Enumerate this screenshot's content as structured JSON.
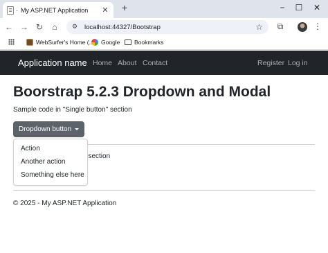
{
  "browser": {
    "tab": {
      "separator": "-",
      "title": "My ASP.NET Application"
    },
    "address": {
      "url": "localhost:44327/Bootstrap"
    },
    "bookmarks": [
      {
        "label": "WebSurfer's Home (...",
        "icon": "websurfer-favicon"
      },
      {
        "label": "Google",
        "icon": "google-favicon"
      },
      {
        "label": "Bookmarks",
        "icon": "folder-icon"
      }
    ]
  },
  "navbar": {
    "brand": "Application name",
    "links": [
      "Home",
      "About",
      "Contact"
    ],
    "right_links": [
      "Register",
      "Log in"
    ],
    "background": "#212529"
  },
  "main": {
    "title": "Boorstrap 5.2.3 Dropdown and Modal",
    "subtitle": "Sample code in \"Single button\" section",
    "dropdown": {
      "button_label": "Dropdown button",
      "button_color": "#5c636a",
      "items": [
        "Action",
        "Another action",
        "Something else here"
      ]
    },
    "partially_hidden_text": "no\" section"
  },
  "footer": {
    "text": "© 2025 - My ASP.NET Application"
  }
}
